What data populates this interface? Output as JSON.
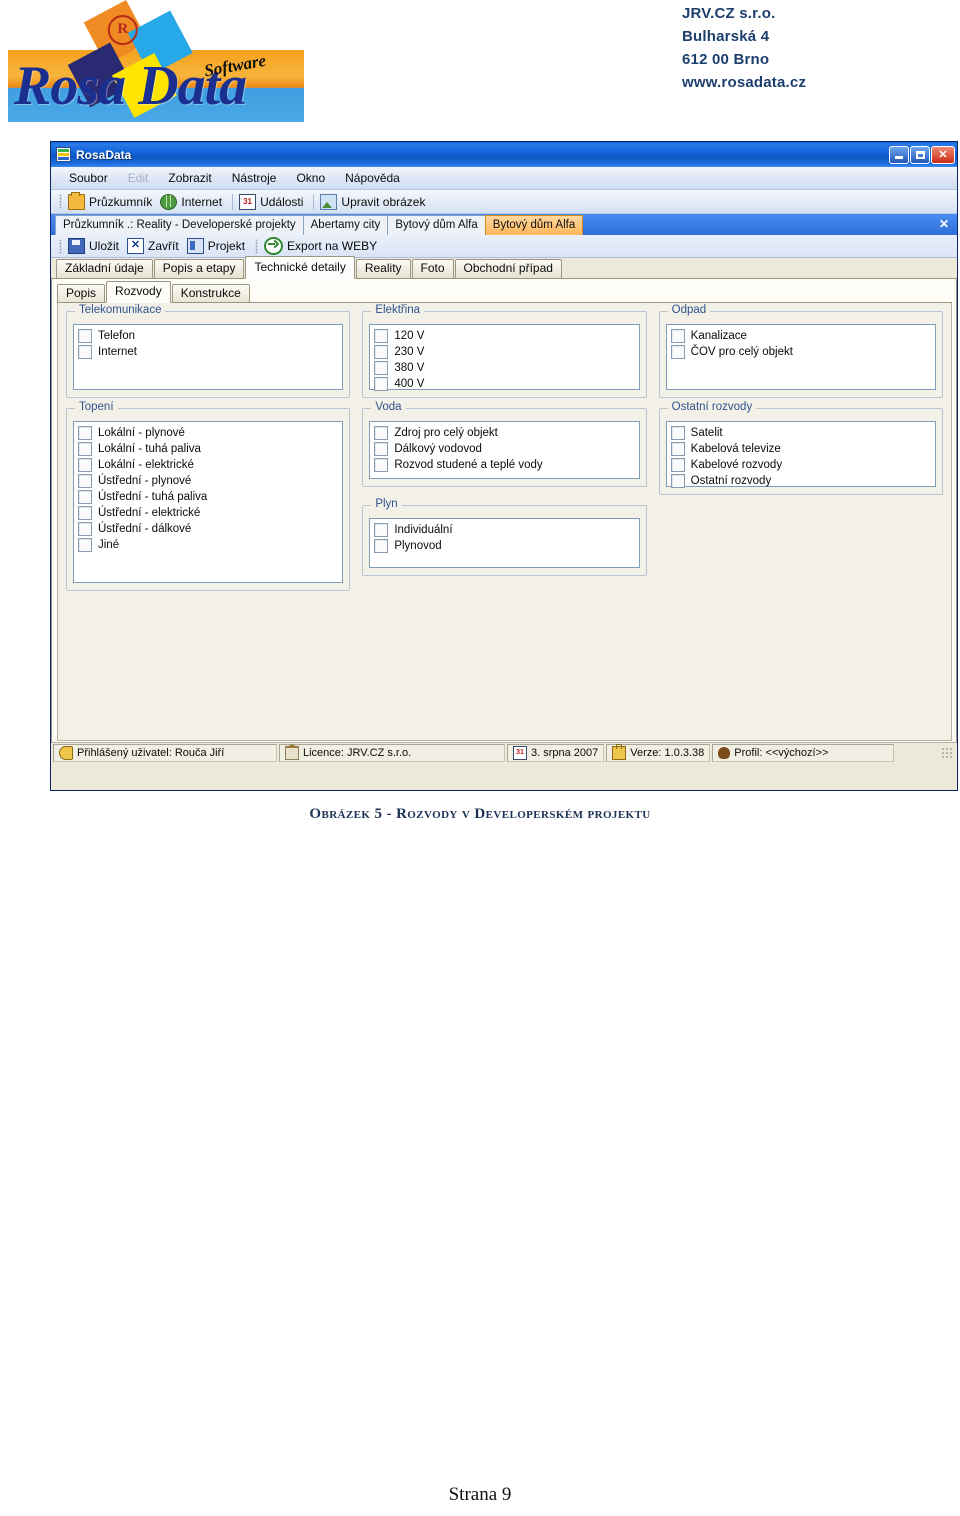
{
  "header": {
    "logo": {
      "wordmark": "Rosa Data",
      "tagline": "Software",
      "registered_mark": "R"
    },
    "contact": [
      "JRV.CZ s.r.o.",
      "Bulharská 4",
      "612 00 Brno",
      "www.rosadata.cz"
    ]
  },
  "window": {
    "title": "RosaData",
    "controls": {
      "minimize": "_",
      "maximize": "□",
      "close": "✕"
    },
    "menu": [
      {
        "label": "Soubor",
        "accel": "S",
        "disabled": false
      },
      {
        "label": "Edit",
        "accel": "E",
        "disabled": true
      },
      {
        "label": "Zobrazit",
        "accel": "Z",
        "disabled": false
      },
      {
        "label": "Nástroje",
        "accel": "N",
        "disabled": false
      },
      {
        "label": "Okno",
        "accel": "O",
        "disabled": false
      },
      {
        "label": "Nápověda",
        "accel": "N",
        "disabled": false
      }
    ],
    "toolbar": [
      {
        "label": "Průzkumník",
        "icon": "folder-icon"
      },
      {
        "label": "Internet",
        "icon": "globe-icon"
      },
      {
        "label": "Události",
        "icon": "calendar-icon",
        "icon_text": "31"
      },
      {
        "label": "Upravit obrázek",
        "icon": "picture-icon"
      }
    ],
    "document_tabs": [
      {
        "label": "Průzkumník .: Reality - Developerské projekty",
        "active": false
      },
      {
        "label": "Abertamy city",
        "active": false
      },
      {
        "label": "Bytový dům Alfa",
        "active": false
      },
      {
        "label": "Bytový dům Alfa",
        "active": true
      }
    ],
    "document_tabs_close": "✕",
    "record_toolbar": [
      {
        "label": "Uložit",
        "icon": "save-icon"
      },
      {
        "label": "Zavřít",
        "icon": "close-x-icon"
      },
      {
        "label": "Projekt",
        "icon": "project-icon"
      },
      {
        "label": "Export na WEBY",
        "icon": "export-arrow-icon"
      }
    ],
    "main_tabs": [
      {
        "label": "Základní údaje",
        "active": false
      },
      {
        "label": "Popis a etapy",
        "active": false
      },
      {
        "label": "Technické detaily",
        "active": true
      },
      {
        "label": "Reality",
        "active": false
      },
      {
        "label": "Foto",
        "active": false
      },
      {
        "label": "Obchodní případ",
        "active": false
      }
    ],
    "sub_tabs": [
      {
        "label": "Popis",
        "active": false
      },
      {
        "label": "Rozvody",
        "active": true
      },
      {
        "label": "Konstrukce",
        "active": false
      }
    ],
    "status_bar": [
      {
        "label": "Přihlášený uživatel: Rouča Jiří",
        "icon": "key-icon"
      },
      {
        "label": "Licence: JRV.CZ s.r.o.",
        "icon": "house-icon"
      },
      {
        "label": "3. srpna 2007",
        "icon": "calendar-icon",
        "icon_text": "31"
      },
      {
        "label": "Verze: 1.0.3.38",
        "icon": "lock-icon"
      },
      {
        "label": "Profil: <<výchozí>>",
        "icon": "profile-icon"
      }
    ]
  },
  "form": {
    "columns": [
      {
        "groups": [
          {
            "legend": "Telekomunikace",
            "min_rows": 4,
            "items": [
              {
                "label": "Telefon",
                "checked": false
              },
              {
                "label": "Internet",
                "checked": false
              }
            ]
          },
          {
            "legend": "Topení",
            "min_rows": 10,
            "items": [
              {
                "label": "Lokální - plynové",
                "checked": false
              },
              {
                "label": "Lokální - tuhá paliva",
                "checked": false
              },
              {
                "label": "Lokální - elektrické",
                "checked": false
              },
              {
                "label": "Ústřední - plynové",
                "checked": false
              },
              {
                "label": "Ústřední - tuhá paliva",
                "checked": false
              },
              {
                "label": "Ústřední - elektrické",
                "checked": false
              },
              {
                "label": "Ústřední - dálkové",
                "checked": false
              },
              {
                "label": "Jiné",
                "checked": false
              }
            ]
          }
        ]
      },
      {
        "groups": [
          {
            "legend": "Elektřina",
            "min_rows": 4,
            "items": [
              {
                "label": "120 V",
                "checked": false
              },
              {
                "label": "230 V",
                "checked": false
              },
              {
                "label": "380 V",
                "checked": false
              },
              {
                "label": "400 V",
                "checked": false
              }
            ]
          },
          {
            "legend": "Voda",
            "min_rows": 4,
            "items": [
              {
                "label": "Zdroj pro celý objekt",
                "checked": false
              },
              {
                "label": "Dálkový vodovod",
                "checked": false
              },
              {
                "label": "Rozvod studené a teplé vody",
                "checked": false
              }
            ]
          },
          {
            "legend": "Plyn",
            "min_rows": 3,
            "items": [
              {
                "label": "Individuální",
                "checked": false
              },
              {
                "label": "Plynovod",
                "checked": false
              }
            ]
          }
        ]
      },
      {
        "groups": [
          {
            "legend": "Odpad",
            "min_rows": 4,
            "items": [
              {
                "label": "Kanalizace",
                "checked": false
              },
              {
                "label": "ČOV pro celý objekt",
                "checked": false
              }
            ]
          },
          {
            "legend": "Ostatní rozvody",
            "min_rows": 4,
            "items": [
              {
                "label": "Satelit",
                "checked": false
              },
              {
                "label": "Kabelová televize",
                "checked": false
              },
              {
                "label": "Kabelové rozvody",
                "checked": false
              },
              {
                "label": "Ostatní rozvody",
                "checked": false
              }
            ]
          }
        ]
      }
    ]
  },
  "caption": "Obrázek 5 - Rozvody v Developerském projektu",
  "footer": "Strana 9",
  "colors": {
    "accent_blue": "#1d3f6e",
    "title_bar": "#0c56c4",
    "active_tab": "#ffb65a",
    "group_legend": "#30538f"
  }
}
